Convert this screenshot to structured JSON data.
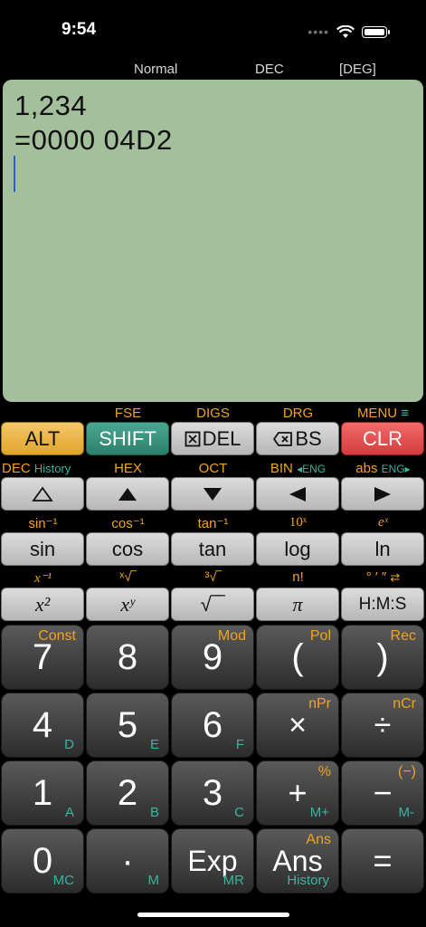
{
  "status": {
    "time": "9:54"
  },
  "mode": {
    "format": "Normal",
    "base": "DEC",
    "angle": "[DEG]"
  },
  "display": {
    "line1": "1,234",
    "line2": "=0000 04D2"
  },
  "row1_labels": [
    "FSE",
    "DIGS",
    "DRG",
    "MENU"
  ],
  "row1": {
    "alt": "ALT",
    "shift": "SHIFT",
    "del": "DEL",
    "bs": "BS",
    "clr": "CLR"
  },
  "row2_labels": {
    "dec": "DEC",
    "history": "History",
    "hex": "HEX",
    "oct": "OCT",
    "bin": "BIN",
    "eng_left": "ENG",
    "abs": "abs",
    "eng_right": "ENG"
  },
  "row3_labels": [
    "sin⁻¹",
    "cos⁻¹",
    "tan⁻¹",
    "10ˣ",
    "eˣ"
  ],
  "row3": [
    "sin",
    "cos",
    "tan",
    "log",
    "ln"
  ],
  "row4_labels": [
    "x⁻¹",
    "ˣ√‾",
    "³√‾",
    "n!",
    "° ′ ″"
  ],
  "row4": [
    "x²",
    "xʸ",
    "√‾‾",
    "π",
    "H:M:S"
  ],
  "keys": {
    "k7": {
      "main": "7",
      "tr": "Const",
      "br": ""
    },
    "k8": {
      "main": "8",
      "tr": "",
      "br": ""
    },
    "k9": {
      "main": "9",
      "tr": "Mod",
      "br": ""
    },
    "kop": {
      "main": "(",
      "tr": "Pol",
      "br": ""
    },
    "kcp": {
      "main": ")",
      "tr": "Rec",
      "br": ""
    },
    "k4": {
      "main": "4",
      "tr": "",
      "br": "D"
    },
    "k5": {
      "main": "5",
      "tr": "",
      "br": "E"
    },
    "k6": {
      "main": "6",
      "tr": "",
      "br": "F"
    },
    "kmul": {
      "main": "×",
      "tr": "nPr",
      "br": ""
    },
    "kdiv": {
      "main": "÷",
      "tr": "nCr",
      "br": ""
    },
    "k1": {
      "main": "1",
      "tr": "",
      "br": "A"
    },
    "k2": {
      "main": "2",
      "tr": "",
      "br": "B"
    },
    "k3": {
      "main": "3",
      "tr": "",
      "br": "C"
    },
    "kadd": {
      "main": "+",
      "tr": "%",
      "br": "M+"
    },
    "ksub": {
      "main": "−",
      "tr": "(−)",
      "br": "M-"
    },
    "k0": {
      "main": "0",
      "tr": "",
      "br": "MC"
    },
    "kdot": {
      "main": "·",
      "tr": "",
      "br": "M"
    },
    "kexp": {
      "main": "Exp",
      "tr": "",
      "br": "MR"
    },
    "kans": {
      "main": "Ans",
      "tr": "Ans",
      "br": "History"
    },
    "keq": {
      "main": "=",
      "tr": "",
      "br": ""
    }
  }
}
